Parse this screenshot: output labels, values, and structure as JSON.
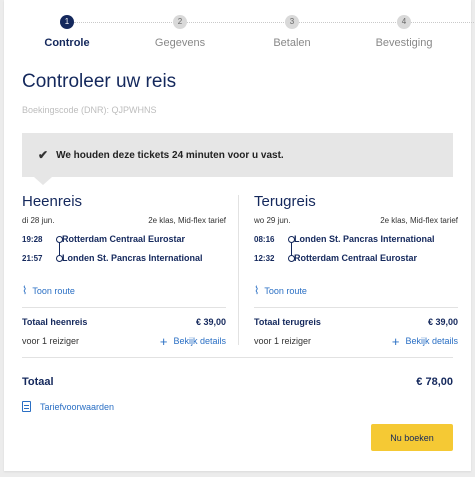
{
  "stepper": {
    "steps": [
      {
        "number": "1",
        "label": "Controle",
        "active": true
      },
      {
        "number": "2",
        "label": "Gegevens",
        "active": false
      },
      {
        "number": "3",
        "label": "Betalen",
        "active": false
      },
      {
        "number": "4",
        "label": "Bevestiging",
        "active": false
      }
    ]
  },
  "page": {
    "title": "Controleer uw reis",
    "booking_code": "Boekingscode (DNR): QJPWHNS"
  },
  "notice": {
    "text": "We houden deze tickets 24 minuten voor u vast.",
    "icon": "check-icon"
  },
  "outbound": {
    "heading": "Heenreis",
    "date": "di 28 jun.",
    "fare": "2e klas, Mid-flex tarief",
    "departure_time": "19:28",
    "departure_station": "Rotterdam Centraal Eurostar",
    "arrival_time": "21:57",
    "arrival_station": "Londen St. Pancras International",
    "route_link": "Toon route",
    "total_label": "Totaal heenreis",
    "total_price": "€ 39,00",
    "travellers": "voor 1 reiziger",
    "details_link": "Bekijk details"
  },
  "inbound": {
    "heading": "Terugreis",
    "date": "wo 29 jun.",
    "fare": "2e klas, Mid-flex tarief",
    "departure_time": "08:16",
    "departure_station": "Londen St. Pancras International",
    "arrival_time": "12:32",
    "arrival_station": "Rotterdam Centraal Eurostar",
    "route_link": "Toon route",
    "total_label": "Totaal terugreis",
    "total_price": "€ 39,00",
    "travellers": "voor 1 reiziger",
    "details_link": "Bekijk details"
  },
  "summary": {
    "total_label": "Totaal",
    "total_price": "€ 78,00",
    "terms_link": "Tariefvoorwaarden",
    "book_button": "Nu boeken"
  },
  "colors": {
    "brand_navy": "#14285c",
    "link_blue": "#2a6fc4",
    "button_yellow": "#f5c934",
    "notice_grey": "#e6e6e6"
  }
}
